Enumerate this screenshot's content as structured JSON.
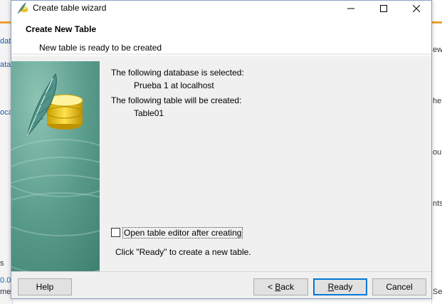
{
  "window": {
    "title": "Create table wizard",
    "controls": [
      "minimize-icon",
      "maximize-icon",
      "close-icon"
    ]
  },
  "header": {
    "title": "Create New Table",
    "subtitle": "New table is ready to be created"
  },
  "summary": {
    "database_label": "The following database is selected:",
    "database_value": "Prueba 1 at localhost",
    "table_label": "The following table will be created:",
    "table_value": "Table01"
  },
  "option": {
    "label": "Open table editor after creating",
    "checked": false
  },
  "hint": "Click \"Ready\" to create a new table.",
  "buttons": {
    "help": "Help",
    "back_mnemonic": "B",
    "back_rest": "ack",
    "back_prefix": "< ",
    "ready_mnemonic": "R",
    "ready_rest": "eady",
    "cancel": "Cancel"
  },
  "background_app": {
    "left_fragments": [
      "dat",
      "ata",
      "oca",
      "s",
      "0.0",
      "me"
    ],
    "right_fragments": [
      "ew",
      "he",
      "ou",
      "nts",
      "Se"
    ]
  },
  "colors": {
    "default_button_border": "#0078d7",
    "side_panel": "#4e8f80"
  }
}
